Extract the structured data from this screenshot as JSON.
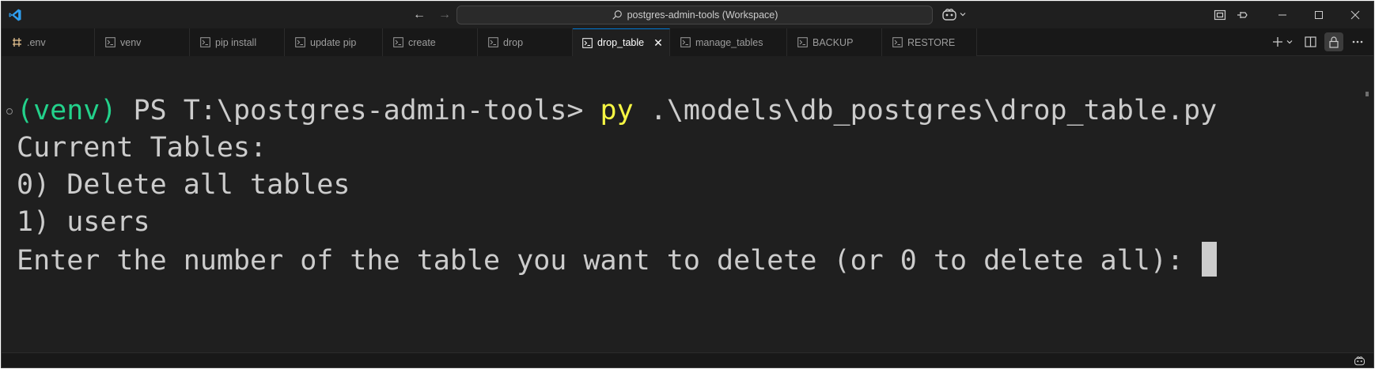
{
  "titlebar": {
    "workspace_title": "postgres-admin-tools (Workspace)",
    "back_icon": "arrow-left-icon",
    "forward_icon": "arrow-right-icon"
  },
  "tabs": [
    {
      "label": ".env",
      "icon": "env-settings-icon",
      "active": false
    },
    {
      "label": "venv",
      "icon": "terminal-icon",
      "active": false
    },
    {
      "label": "pip install",
      "icon": "terminal-icon",
      "active": false
    },
    {
      "label": "update pip",
      "icon": "terminal-icon",
      "active": false
    },
    {
      "label": "create",
      "icon": "terminal-icon",
      "active": false
    },
    {
      "label": "drop",
      "icon": "terminal-icon",
      "active": false
    },
    {
      "label": "drop_table",
      "icon": "terminal-icon",
      "active": true
    },
    {
      "label": "manage_tables",
      "icon": "terminal-icon",
      "active": false
    },
    {
      "label": "BACKUP",
      "icon": "terminal-icon",
      "active": false
    },
    {
      "label": "RESTORE",
      "icon": "terminal-icon",
      "active": false
    }
  ],
  "terminal": {
    "prompt_env": "(venv)",
    "prompt_path": " PS T:\\postgres-admin-tools> ",
    "command": "py",
    "command_args": " .\\models\\db_postgres\\drop_table.py",
    "lines": [
      "Current Tables:",
      "0) Delete all tables",
      "1) users",
      "Enter the number of the table you want to delete (or 0 to delete all): "
    ]
  },
  "colors": {
    "background": "#1f1f1f",
    "venv_green": "#23d18b",
    "command_yellow": "#f5f543",
    "accent_blue": "#0078d4",
    "text": "#cccccc"
  }
}
